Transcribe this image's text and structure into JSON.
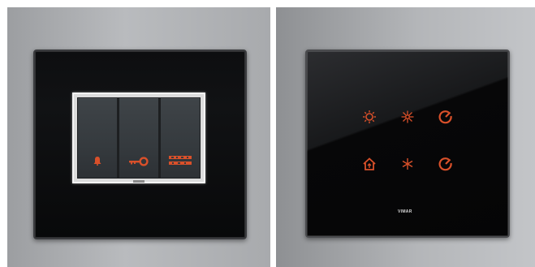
{
  "photos": {
    "left": {
      "description_id": "rocker-switch-plate",
      "accent_color": "#d9502a",
      "rockers": [
        "bell",
        "key",
        "do-not-disturb"
      ]
    },
    "right": {
      "description_id": "touch-control-plate",
      "accent_color": "#d9502a",
      "brand_text": "VIMAR",
      "icons": [
        "sun-icon",
        "fan-icon",
        "power-icon",
        "home-icon",
        "snowflake-icon",
        "power-icon"
      ]
    }
  }
}
